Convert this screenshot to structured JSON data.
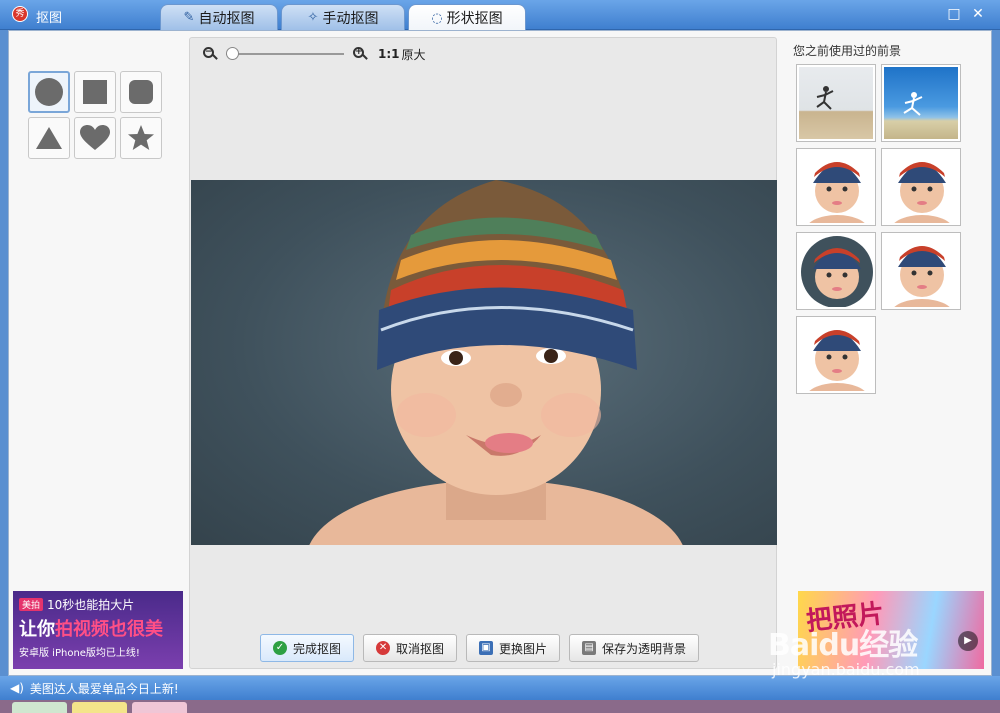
{
  "window": {
    "title": "抠图",
    "app_logo_text": "秀"
  },
  "tabs": [
    {
      "label": "自动抠图",
      "icon": "brush-icon",
      "active": false
    },
    {
      "label": "手动抠图",
      "icon": "magic-wand-icon",
      "active": false
    },
    {
      "label": "形状抠图",
      "icon": "lasso-icon",
      "active": true
    }
  ],
  "window_controls": {
    "maximize": "□",
    "close": "✕"
  },
  "shapes": [
    {
      "name": "circle",
      "selected": true
    },
    {
      "name": "square",
      "selected": false
    },
    {
      "name": "rounded-square",
      "selected": false
    },
    {
      "name": "triangle",
      "selected": false
    },
    {
      "name": "heart",
      "selected": false
    },
    {
      "name": "star",
      "selected": false
    }
  ],
  "zoom": {
    "ratio_label": "1:1",
    "original_label": "原大",
    "level": 0
  },
  "actions": {
    "finish": "完成抠图",
    "cancel": "取消抠图",
    "change": "更换图片",
    "save_transparent": "保存为透明背景"
  },
  "history": {
    "title": "您之前使用过的前景",
    "items": [
      "runner-beach",
      "runner-blue-sky",
      "baby-hat",
      "baby-hat",
      "baby-hat-circle",
      "baby-hat",
      "baby-hat"
    ]
  },
  "ads": {
    "left": {
      "logo": "美拍",
      "line1": "10秒也能拍大片",
      "line2_prefix": "让你",
      "line2_highlight": "拍视频也很美",
      "line3": "安卓版 iPhone版均已上线!"
    },
    "right": {
      "text": "把照片"
    }
  },
  "status": {
    "message": "美图达人最爱单品今日上新!"
  },
  "watermark": {
    "line1": "Baidu经验",
    "line2": "jingyan.baidu.com"
  },
  "colors": {
    "accent": "#4a86d6",
    "selected_border": "#7aa6d8",
    "shape_fill": "#6b6b6b"
  }
}
